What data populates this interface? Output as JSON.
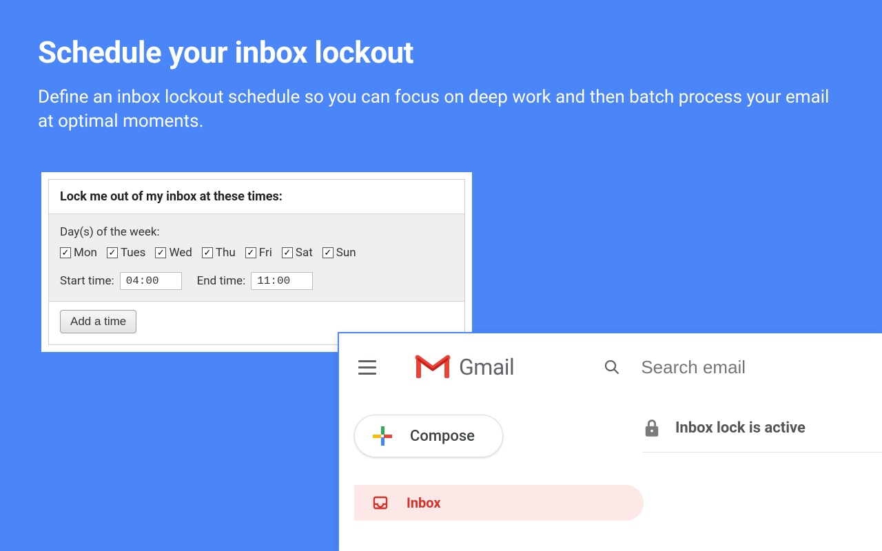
{
  "hero": {
    "title": "Schedule your inbox lockout",
    "subtitle": "Define an inbox lockout schedule so you can focus on deep work and then batch process your email at optimal moments."
  },
  "schedule": {
    "header": "Lock me out of my inbox at these times:",
    "dow_label": "Day(s) of the week:",
    "days": [
      {
        "label": "Mon",
        "checked": true
      },
      {
        "label": "Tues",
        "checked": true
      },
      {
        "label": "Wed",
        "checked": true
      },
      {
        "label": "Thu",
        "checked": true
      },
      {
        "label": "Fri",
        "checked": true
      },
      {
        "label": "Sat",
        "checked": true
      },
      {
        "label": "Sun",
        "checked": true
      }
    ],
    "start_label": "Start time:",
    "start_value": "04:00",
    "end_label": "End time:",
    "end_value": "11:00",
    "add_button": "Add a time"
  },
  "gmail": {
    "brand": "Gmail",
    "search_placeholder": "Search email",
    "compose": "Compose",
    "inbox": "Inbox",
    "lock_banner": "Inbox lock is active"
  }
}
